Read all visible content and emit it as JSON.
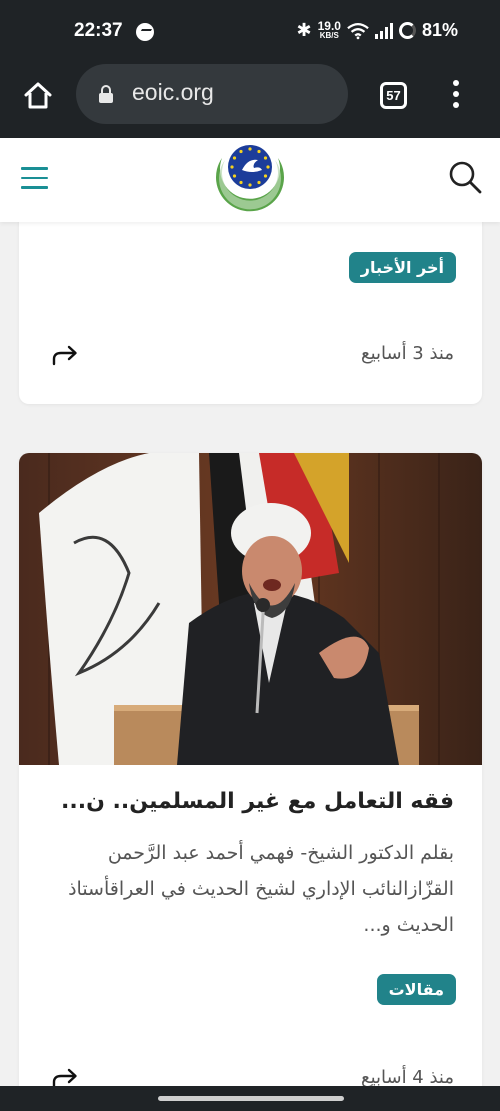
{
  "status_bar": {
    "time": "22:37",
    "net_speed_value": "19.0",
    "net_speed_unit": "KB/S",
    "battery": "81%"
  },
  "browser": {
    "url": "eoic.org",
    "tab_count": "57"
  },
  "cards": [
    {
      "tag": "أخر الأخبار",
      "time_ago": "منذ 3 أسابيع"
    },
    {
      "title": "فقه التعامل مع غير المسلمين.. ن...",
      "excerpt": "بقلم الدكتور الشيخ- فهمي أحمد عبد الرَّحمن القزّازالنائب الإداري لشيخ الحديث في العراقأستاذ الحديث و...",
      "tag": "مقالات",
      "time_ago": "منذ 4 أسابيع"
    }
  ],
  "colors": {
    "accent": "#21838a",
    "system_bar": "#1f2326"
  }
}
